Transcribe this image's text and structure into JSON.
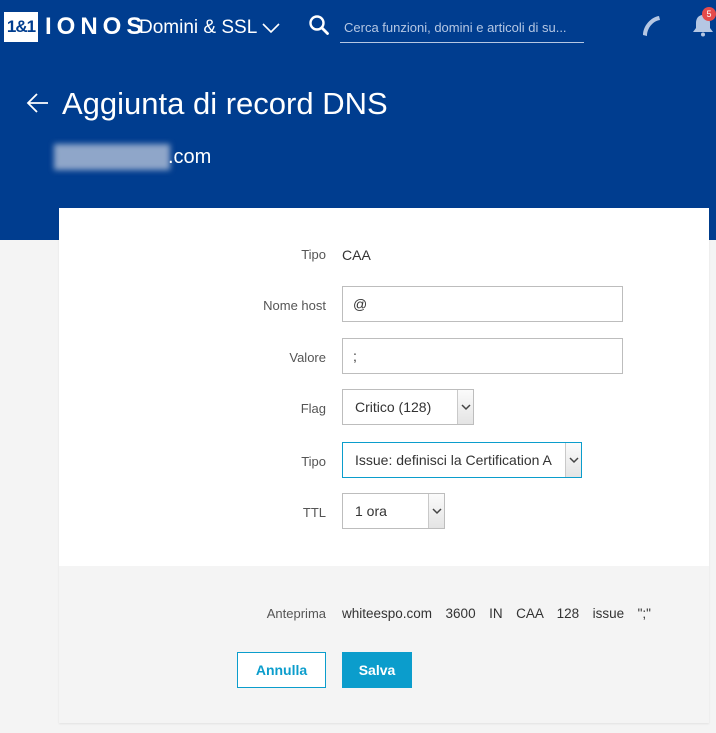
{
  "topbar": {
    "logo_box": "1&1",
    "logo_text": "IONOS",
    "nav_menu_label": "Domini & SSL",
    "search_placeholder": "Cerca funzioni, domini e articoli di su...",
    "notification_count": "5",
    "icons": [
      "chevron-down-icon",
      "search-icon",
      "phone-icon",
      "bell-icon"
    ]
  },
  "header": {
    "back_icon": "arrow-left-icon",
    "title": "Aggiunta di record DNS",
    "domain_suffix": ".com"
  },
  "form": {
    "record_type_label": "Tipo",
    "record_type_value": "CAA",
    "host_label": "Nome host",
    "host_value": "@",
    "value_label": "Valore",
    "value_value": ";",
    "flag_label": "Flag",
    "flag_value": "Critico (128)",
    "tag_label": "Tipo",
    "tag_value": "Issue: definisci la Certification A",
    "ttl_label": "TTL",
    "ttl_value": "1 ora"
  },
  "preview": {
    "label": "Anteprima",
    "value": "whiteespo.com  3600  IN  CAA  128  issue  \";\""
  },
  "actions": {
    "cancel_label": "Annulla",
    "save_label": "Salva"
  },
  "colors": {
    "brand_blue": "#003d8f",
    "accent": "#0b9dcc",
    "badge": "#e44b4b"
  }
}
